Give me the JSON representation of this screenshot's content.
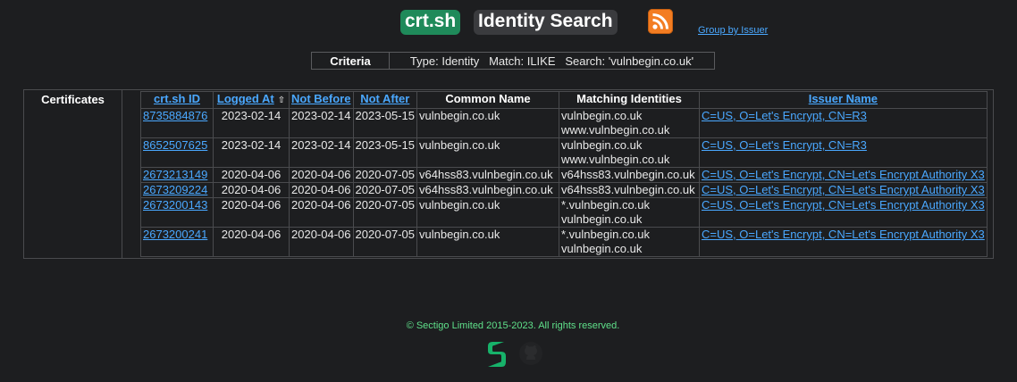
{
  "header": {
    "logo_text": "crt.sh",
    "title": "Identity Search",
    "feed_icon": "rss-feed-icon",
    "group_by_issuer": "Group by Issuer"
  },
  "criteria": {
    "label": "Criteria",
    "value": "Type: Identity   Match: ILIKE   Search: 'vulnbegin.co.uk'"
  },
  "certificates": {
    "section_label": "Certificates",
    "columns": [
      "crt.sh ID",
      "Logged At",
      "Not Before",
      "Not After",
      "Common Name",
      "Matching Identities",
      "Issuer Name"
    ],
    "sort_indicator": "⇧",
    "rows": [
      {
        "id": "8735884876",
        "logged_at": "2023-02-14",
        "not_before": "2023-02-14",
        "not_after": "2023-05-15",
        "common_name": "vulnbegin.co.uk",
        "identity_1": "vulnbegin.co.uk",
        "identity_2": "www.vulnbegin.co.uk",
        "issuer": "C=US, O=Let's Encrypt, CN=R3"
      },
      {
        "id": "8652507625",
        "logged_at": "2023-02-14",
        "not_before": "2023-02-14",
        "not_after": "2023-05-15",
        "common_name": "vulnbegin.co.uk",
        "identity_1": "vulnbegin.co.uk",
        "identity_2": "www.vulnbegin.co.uk",
        "issuer": "C=US, O=Let's Encrypt, CN=R3"
      },
      {
        "id": "2673213149",
        "logged_at": "2020-04-06",
        "not_before": "2020-04-06",
        "not_after": "2020-07-05",
        "common_name": "v64hss83.vulnbegin.co.uk",
        "identity_1": "v64hss83.vulnbegin.co.uk",
        "identity_2": "",
        "issuer": "C=US, O=Let's Encrypt, CN=Let's Encrypt Authority X3"
      },
      {
        "id": "2673209224",
        "logged_at": "2020-04-06",
        "not_before": "2020-04-06",
        "not_after": "2020-07-05",
        "common_name": "v64hss83.vulnbegin.co.uk",
        "identity_1": "v64hss83.vulnbegin.co.uk",
        "identity_2": "",
        "issuer": "C=US, O=Let's Encrypt, CN=Let's Encrypt Authority X3"
      },
      {
        "id": "2673200143",
        "logged_at": "2020-04-06",
        "not_before": "2020-04-06",
        "not_after": "2020-07-05",
        "common_name": "vulnbegin.co.uk",
        "identity_1": "*.vulnbegin.co.uk",
        "identity_2": "vulnbegin.co.uk",
        "issuer": "C=US, O=Let's Encrypt, CN=Let's Encrypt Authority X3"
      },
      {
        "id": "2673200241",
        "logged_at": "2020-04-06",
        "not_before": "2020-04-06",
        "not_after": "2020-07-05",
        "common_name": "vulnbegin.co.uk",
        "identity_1": "*.vulnbegin.co.uk",
        "identity_2": "vulnbegin.co.uk",
        "issuer": "C=US, O=Let's Encrypt, CN=Let's Encrypt Authority X3"
      }
    ]
  },
  "footer": {
    "copyright": "© Sectigo Limited 2015-2023. All rights reserved.",
    "sectigo_icon": "sectigo-logo-icon",
    "github_icon": "github-icon"
  },
  "colors": {
    "background": "#1d1e20",
    "link": "#4aa8ff",
    "logo_green": "#1f8a5a",
    "rss_orange": "#f37d22",
    "copyright_green": "#5fe08a"
  }
}
